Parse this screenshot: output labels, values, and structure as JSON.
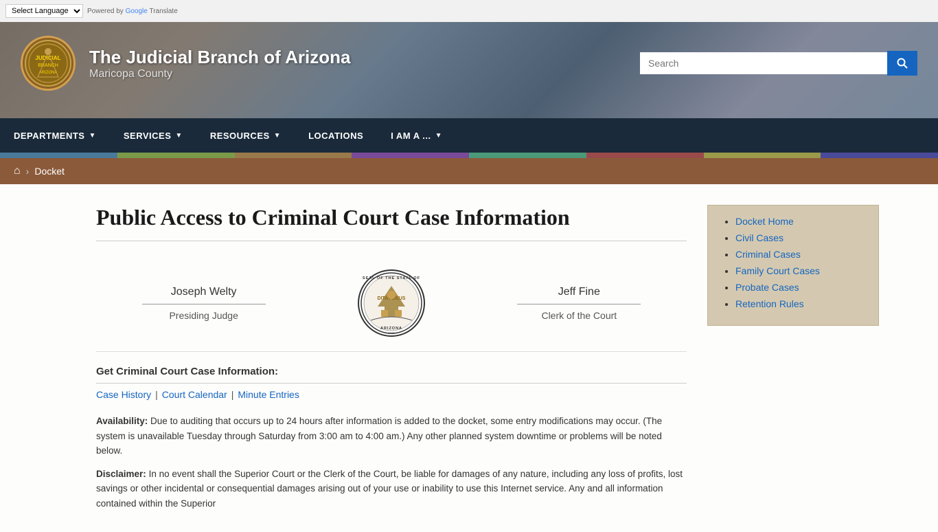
{
  "topbar": {
    "select_label": "Select Language",
    "powered_text": "Powered by",
    "google_text": "Google",
    "translate_text": "Translate"
  },
  "header": {
    "site_title": "The Judicial Branch of Arizona",
    "site_subtitle": "Maricopa County",
    "search_placeholder": "Search",
    "search_button_label": "🔍"
  },
  "navbar": {
    "items": [
      {
        "label": "DEPARTMENTS",
        "has_dropdown": true
      },
      {
        "label": "SERVICES",
        "has_dropdown": true
      },
      {
        "label": "RESOURCES",
        "has_dropdown": true
      },
      {
        "label": "LOCATIONS",
        "has_dropdown": false
      },
      {
        "label": "I AM A ...",
        "has_dropdown": true
      }
    ]
  },
  "breadcrumb": {
    "home_label": "Home",
    "current_label": "Docket"
  },
  "page": {
    "heading": "Public Access to Criminal Court Case Information",
    "judge": {
      "left_name": "Joseph Welty",
      "left_title": "Presiding Judge",
      "right_name": "Jeff Fine",
      "right_title": "Clerk of the Court"
    },
    "get_info_heading": "Get Criminal Court Case Information:",
    "case_links": [
      {
        "label": "Case History"
      },
      {
        "label": "Court Calendar"
      },
      {
        "label": "Minute Entries"
      }
    ],
    "availability_label": "Availability:",
    "availability_text": "Due to auditing that occurs up to 24 hours after information is added to the docket, some entry modifications may occur. (The system is unavailable Tuesday through Saturday from 3:00 am to 4:00 am.) Any other planned system downtime or problems will be noted below.",
    "disclaimer_label": "Disclaimer:",
    "disclaimer_text": "In no event shall the Superior Court or the Clerk of the Court, be liable for damages of any nature, including any loss of profits, lost savings or other incidental or consequential damages arising out of your use or inability to use this Internet service. Any and all information contained within the Superior"
  },
  "sidebar": {
    "items": [
      {
        "label": "Docket Home"
      },
      {
        "label": "Civil Cases"
      },
      {
        "label": "Criminal Cases"
      },
      {
        "label": "Family Court Cases"
      },
      {
        "label": "Probate Cases"
      },
      {
        "label": "Retention Rules"
      }
    ]
  }
}
